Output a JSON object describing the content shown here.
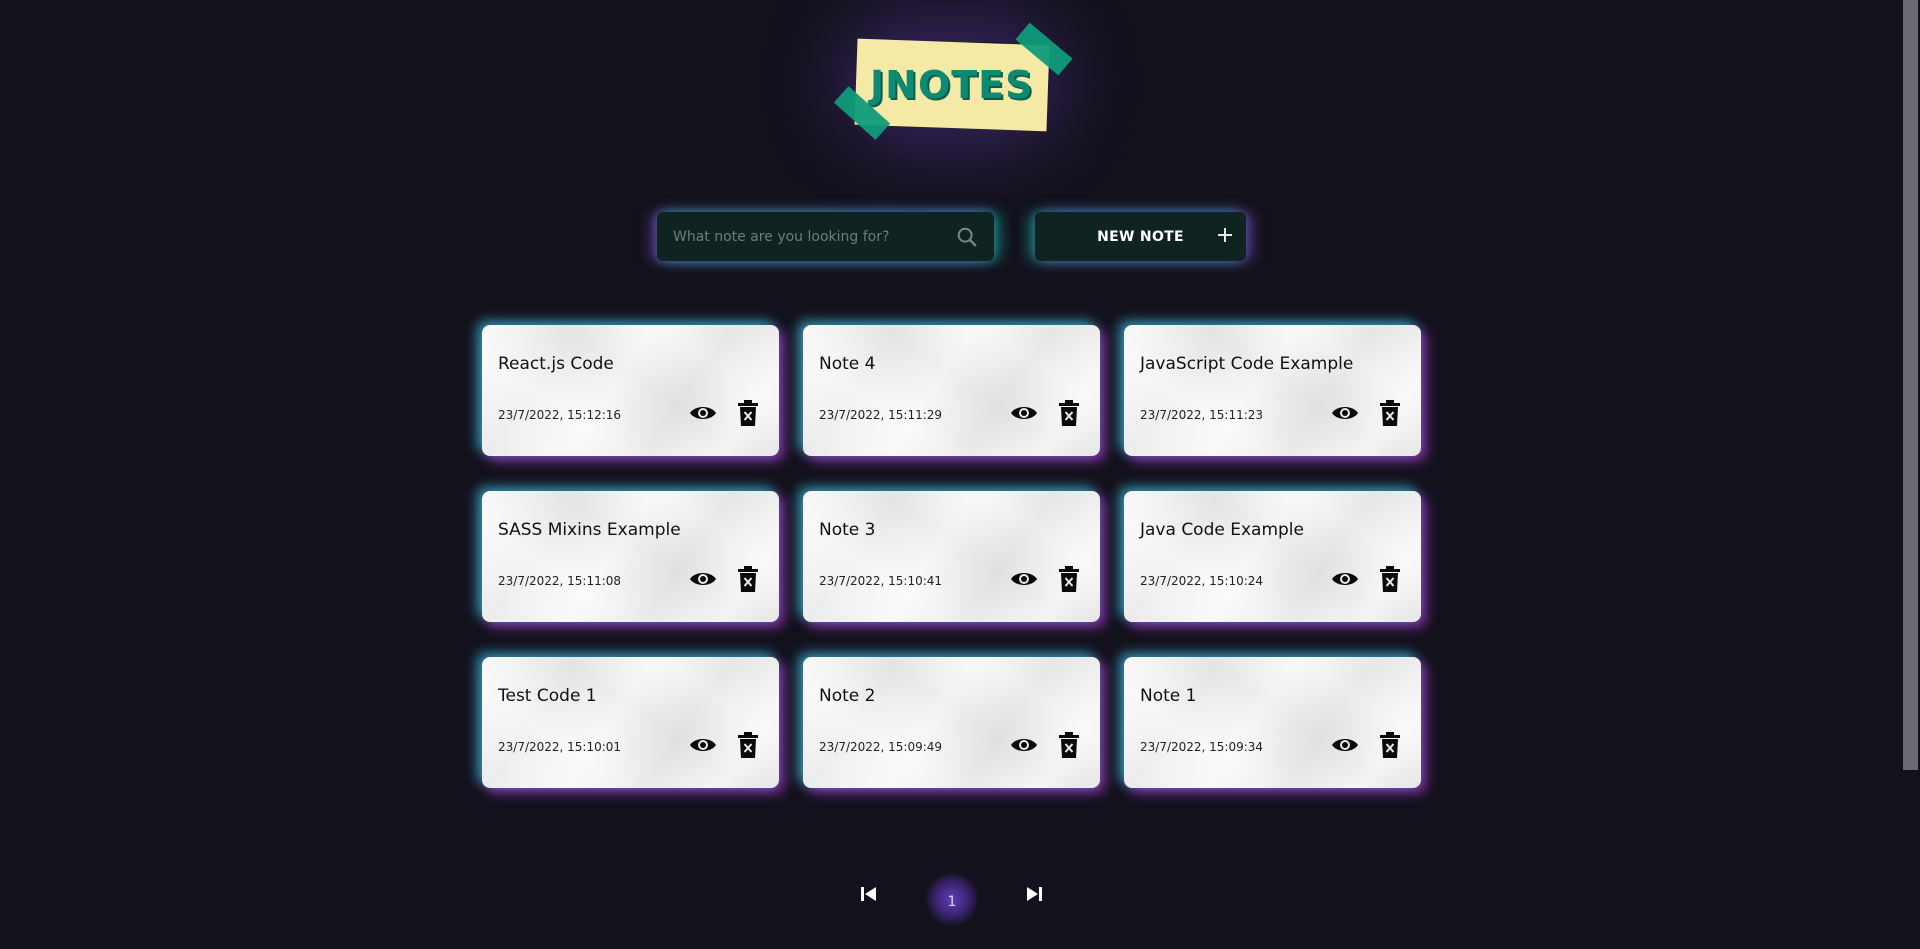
{
  "logo": {
    "text": "JNOTES"
  },
  "search": {
    "placeholder": "What note are you looking for?",
    "value": ""
  },
  "toolbar": {
    "new_note_label": "NEW NOTE",
    "new_note_icon": "plus-icon"
  },
  "notes": [
    {
      "title": "React.js Code",
      "date": "23/7/2022, 15:12:16"
    },
    {
      "title": "Note 4",
      "date": "23/7/2022, 15:11:29"
    },
    {
      "title": "JavaScript Code Example",
      "date": "23/7/2022, 15:11:23"
    },
    {
      "title": "SASS Mixins Example",
      "date": "23/7/2022, 15:11:08"
    },
    {
      "title": "Note 3",
      "date": "23/7/2022, 15:10:41"
    },
    {
      "title": "Java Code Example",
      "date": "23/7/2022, 15:10:24"
    },
    {
      "title": "Test Code 1",
      "date": "23/7/2022, 15:10:01"
    },
    {
      "title": "Note 2",
      "date": "23/7/2022, 15:09:49"
    },
    {
      "title": "Note 1",
      "date": "23/7/2022, 15:09:34"
    }
  ],
  "pagination": {
    "current_page": "1"
  },
  "colors": {
    "background": "#13111c",
    "accent_teal": "#0e8a73",
    "accent_purple": "#8c50dc",
    "glow_cyan": "#3cc8e6",
    "note_paper": "#f4f4f4",
    "logo_note": "#f5eaa5"
  }
}
